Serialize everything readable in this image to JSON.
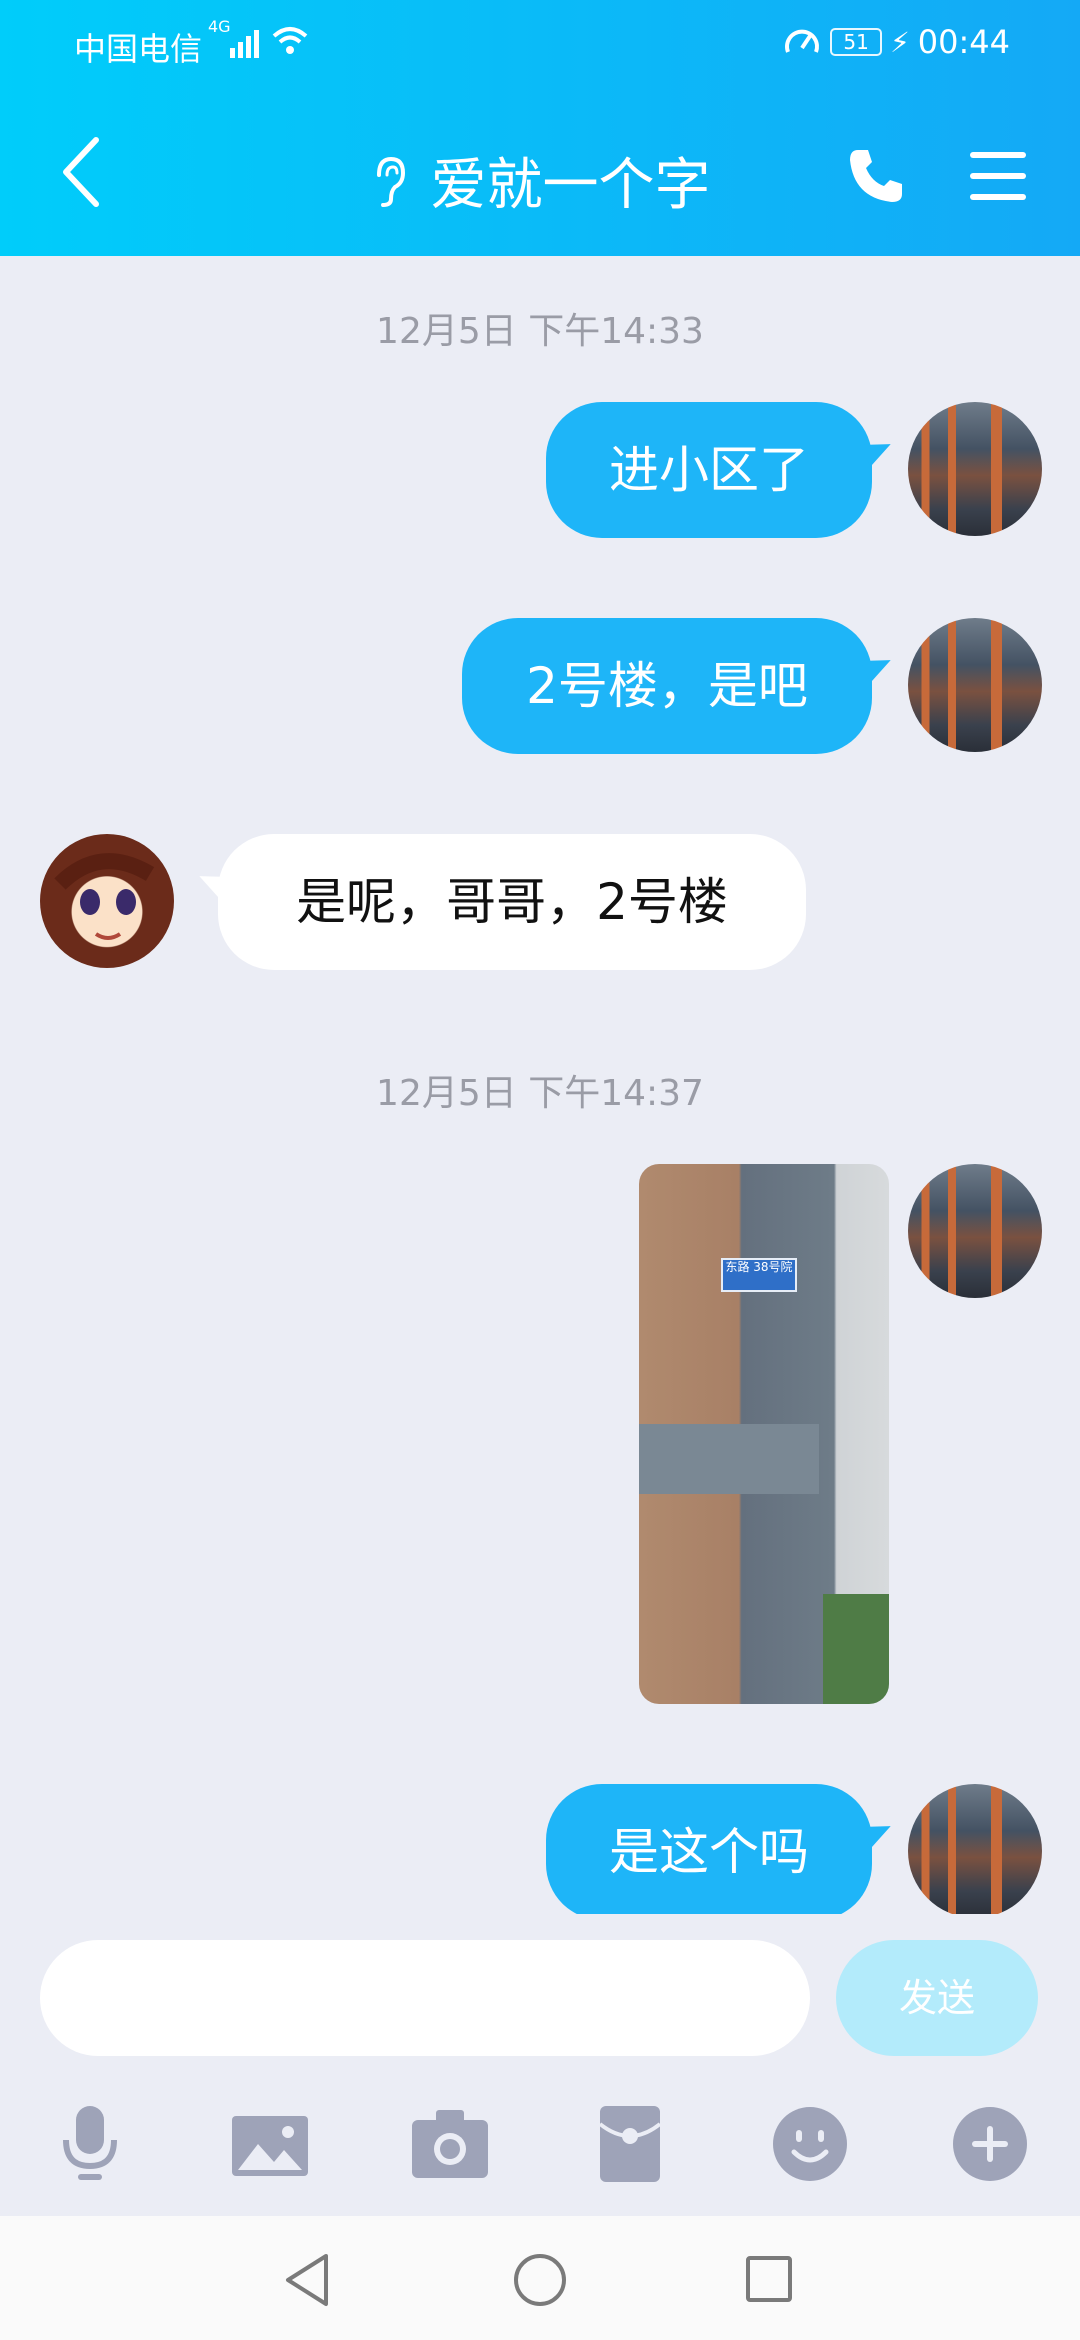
{
  "status_bar": {
    "carrier": "中国电信",
    "network": "4G",
    "battery": "51",
    "time": "00:44"
  },
  "header": {
    "title": "爱就一个字"
  },
  "messages": [
    {
      "type": "time",
      "text": "12月5日 下午14:33"
    },
    {
      "type": "out",
      "text": "进小区了"
    },
    {
      "type": "out",
      "text": "2号楼，是吧"
    },
    {
      "type": "in",
      "text": "是呢，哥哥，2号楼"
    },
    {
      "type": "time",
      "text": "12月5日 下午14:37"
    },
    {
      "type": "out_image",
      "sign_text": "东路 38号院"
    },
    {
      "type": "out",
      "text": "是这个吗"
    }
  ],
  "composer": {
    "input_value": "",
    "send_label": "发送"
  },
  "toolbar": [
    "microphone-icon",
    "picture-icon",
    "camera-icon",
    "red-packet-icon",
    "emoji-icon",
    "plus-icon"
  ],
  "colors": {
    "header_start": "#00cdfa",
    "header_end": "#14a9f6",
    "bubble_out": "#1eb5f8",
    "bubble_in": "#ffffff",
    "background": "#ebedf5",
    "send_disabled": "#b3ebfb",
    "toolbar_icon": "#9ea3b8"
  }
}
